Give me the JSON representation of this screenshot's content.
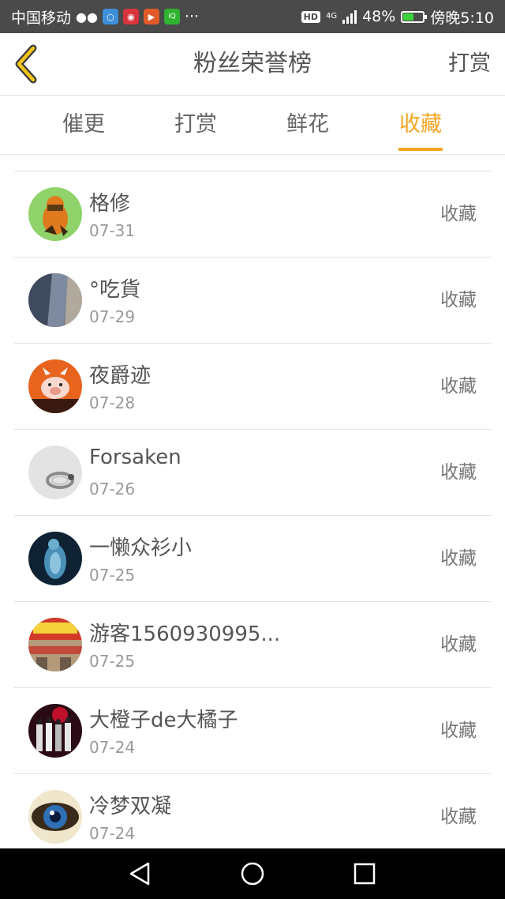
{
  "status_bar": {
    "carrier": "中国移动",
    "hd": "HD",
    "network": "4G",
    "battery": "48%",
    "time": "傍晚5:10"
  },
  "header": {
    "title": "粉丝荣誉榜",
    "right_action": "打赏"
  },
  "tabs": [
    {
      "label": "催更",
      "active": false
    },
    {
      "label": "打赏",
      "active": false
    },
    {
      "label": "鲜花",
      "active": false
    },
    {
      "label": "收藏",
      "active": true
    }
  ],
  "colors": {
    "accent": "#f5a623",
    "statusbar": "#4a4a4a"
  },
  "fans": [
    {
      "name": "格修",
      "date": "07-31",
      "action": "收藏",
      "avatar": "green-dinosaur"
    },
    {
      "name": "°吃貨",
      "date": "07-29",
      "action": "收藏",
      "avatar": "dark-hair"
    },
    {
      "name": "夜爵迹",
      "date": "07-28",
      "action": "收藏",
      "avatar": "orange-cartoon-pig"
    },
    {
      "name": "Forsaken",
      "date": "07-26",
      "action": "收藏",
      "avatar": "silver-ring"
    },
    {
      "name": "一懒众衫小",
      "date": "07-25",
      "action": "收藏",
      "avatar": "blue-figure"
    },
    {
      "name": "游客1560930995...",
      "date": "07-25",
      "action": "收藏",
      "avatar": "red-signboard"
    },
    {
      "name": "大橙子de大橘子",
      "date": "07-24",
      "action": "收藏",
      "avatar": "group-photo"
    },
    {
      "name": "冷梦双凝",
      "date": "07-24",
      "action": "收藏",
      "avatar": "blue-eye"
    }
  ]
}
